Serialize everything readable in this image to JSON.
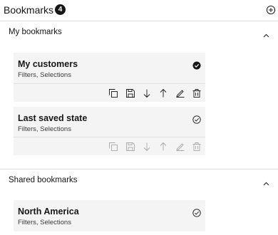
{
  "panel": {
    "title": "Bookmarks",
    "count": "4"
  },
  "sections": [
    {
      "label": "My bookmarks",
      "expanded": true,
      "items": [
        {
          "name": "My customers",
          "subtitle": "Filters, Selections",
          "applied": true,
          "toolbar_enabled": true
        },
        {
          "name": "Last saved state",
          "subtitle": "Filters, Selections",
          "applied": false,
          "toolbar_enabled": false
        }
      ]
    },
    {
      "label": "Shared bookmarks",
      "expanded": true,
      "items": [
        {
          "name": "North America",
          "subtitle": "Filters, Selections",
          "applied": false
        }
      ]
    }
  ],
  "icons": {
    "add": "add-circle-icon",
    "collapse": "chevron-up-icon",
    "applied": "checkmark-filled-icon",
    "not_applied": "checkmark-outline-icon",
    "toolbar": [
      "copy-icon",
      "save-icon",
      "arrow-down-icon",
      "arrow-up-icon",
      "edit-icon",
      "delete-icon"
    ]
  },
  "colors": {
    "text": "#161616",
    "card_bg": "#f4f4f4",
    "divider": "#e0e0e0",
    "icon_enabled": "#161616",
    "icon_disabled": "#a8a8a8"
  }
}
